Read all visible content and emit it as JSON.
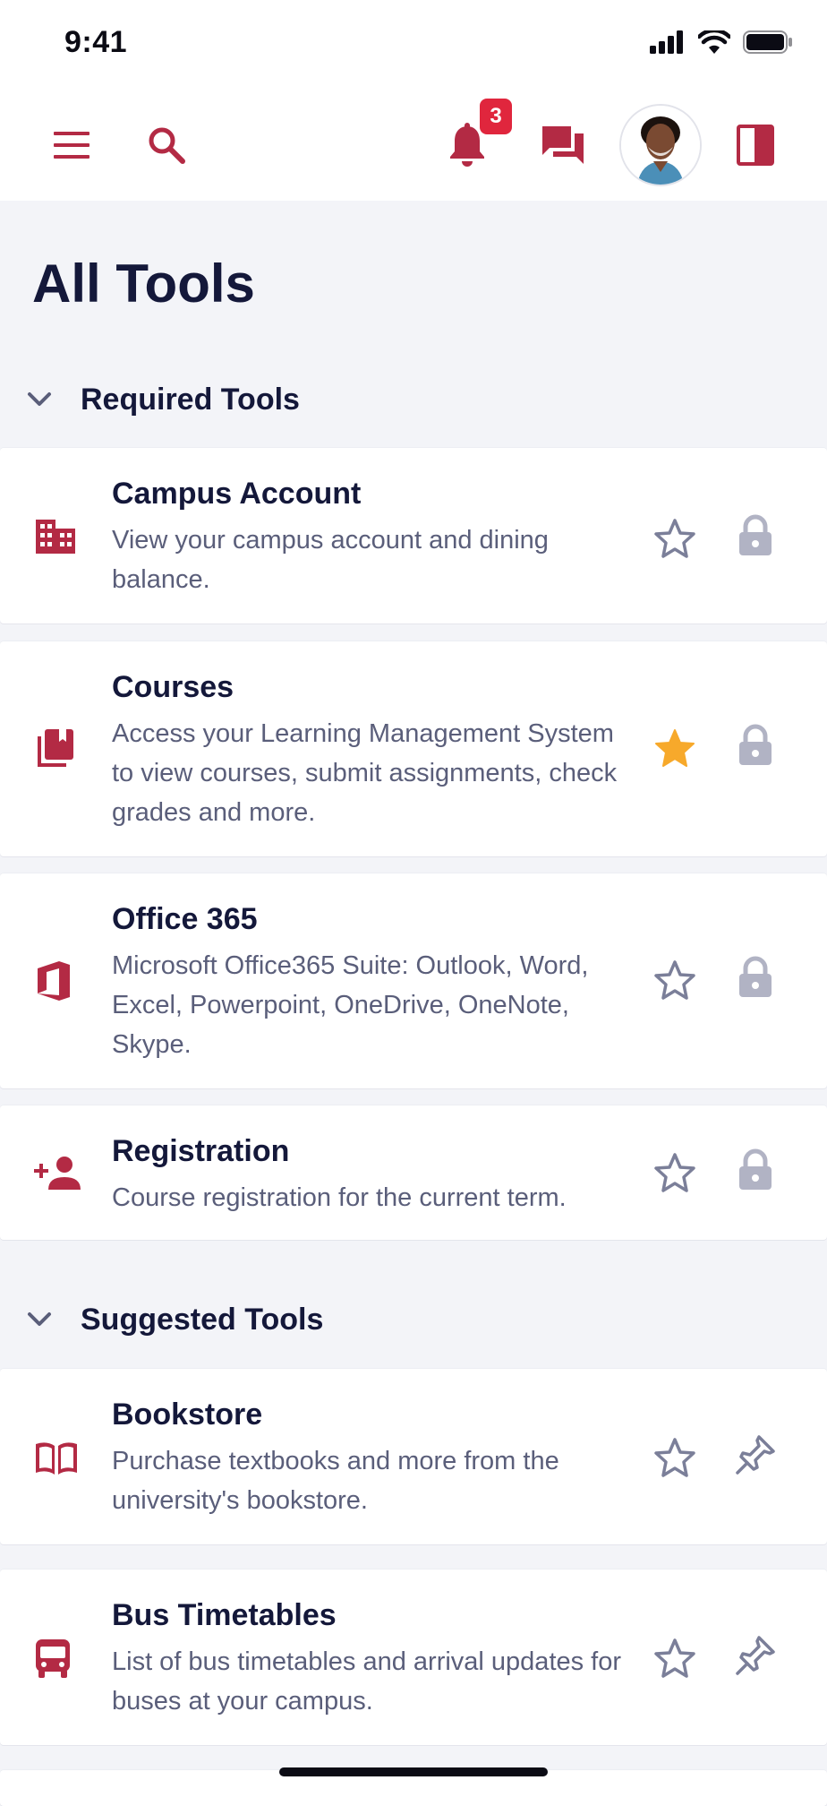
{
  "status_bar": {
    "time": "9:41"
  },
  "header": {
    "notification_count": "3",
    "accent_color": "#b32a44",
    "icons": [
      "menu-icon",
      "search-icon",
      "bell-icon",
      "chat-icon",
      "avatar",
      "panel-icon"
    ]
  },
  "page_title": "All Tools",
  "sections": [
    {
      "label": "Required Tools",
      "tools": [
        {
          "title": "Campus Account",
          "description": "View your campus account and dining balance.",
          "icon": "building-icon",
          "favorited": false,
          "action_icon": "lock-icon"
        },
        {
          "title": "Courses",
          "description": "Access your Learning Management System to view courses, submit assignments, check grades and more.",
          "icon": "book-stack-icon",
          "favorited": true,
          "action_icon": "lock-icon"
        },
        {
          "title": "Office 365",
          "description": "Microsoft Office365 Suite: Outlook, Word, Excel, Powerpoint, OneDrive, OneNote, Skype.",
          "icon": "office-icon",
          "favorited": false,
          "action_icon": "lock-icon"
        },
        {
          "title": "Registration",
          "description": "Course registration for the current term.",
          "icon": "add-person-icon",
          "favorited": false,
          "action_icon": "lock-icon"
        }
      ]
    },
    {
      "label": "Suggested Tools",
      "tools": [
        {
          "title": "Bookstore",
          "description": "Purchase textbooks and more from the university's bookstore.",
          "icon": "open-book-icon",
          "favorited": false,
          "action_icon": "pin-icon"
        },
        {
          "title": "Bus Timetables",
          "description": "List of bus timetables and arrival updates for buses at your campus.",
          "icon": "bus-icon",
          "favorited": false,
          "action_icon": "pin-icon"
        }
      ]
    }
  ]
}
